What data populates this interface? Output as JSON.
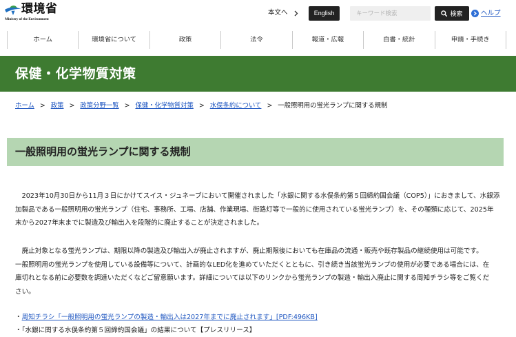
{
  "header": {
    "logo": {
      "title": "環境省",
      "subtitle": "Ministry of the Environment",
      "icon": "ministry-logo-icon"
    },
    "skip_link": {
      "label": "本文へ",
      "icon": "chevron-right-icon"
    },
    "english_button": {
      "label": "English"
    },
    "search": {
      "placeholder": "キーワード検索",
      "value": "",
      "button_label": "検索",
      "button_icon": "search-icon"
    },
    "help_link": {
      "label": "ヘルプ",
      "icon": "chevron-circle-right-icon"
    }
  },
  "nav": {
    "items": [
      "ホーム",
      "環境省について",
      "政策",
      "法令",
      "報道・広報",
      "白書・統計",
      "申請・手続き"
    ]
  },
  "section_banner": {
    "title": "保健・化学物質対策"
  },
  "breadcrumb": {
    "separator": ">",
    "links": [
      "ホーム",
      "政策",
      "政策分野一覧",
      "保健・化学物質対策",
      "水俣条約について"
    ],
    "current": "一般照明用の蛍光ランプに関する規制"
  },
  "main": {
    "heading": "一般照明用の蛍光ランプに関する規制",
    "paragraphs": [
      {
        "lines": [
          "2023年10月30日から11月３日にかけてスイス・ジュネーブにおいて開催されました「水銀に関する水俣条約第５回締約国会議（COP5）」におきまして、水銀添",
          "加製品である一般照明用の蛍光ランプ（住宅、事務所、工場、店舗、作業現場、街路灯等で一般的に使用されている蛍光ランプ）を、その種類に応じて、2025年",
          "末から2027年末までに製造及び輸出入を段階的に廃止することが決定されました。"
        ]
      },
      {
        "lines": [
          "廃止対象となる蛍光ランプは、期限以降の製造及び輸出入が廃止されますが、廃止期限後においても在庫品の流通・販売や既存製品の継続使用は可能です。",
          "一般照明用の蛍光ランプを使用している設備等について、計画的なLED化を進めていただくとともに、引き続き当該蛍光ランプの使用が必要である場合には、在",
          "庫切れとなる前に必要数を調達いただくなどご留意願います。詳細については以下のリンクから蛍光ランプの製造・輸出入廃止に関する周知チラシ等をご覧くだ",
          "さい。"
        ]
      }
    ],
    "links": [
      {
        "bullet": "・",
        "label": "周知チラシ「一般照明用の蛍光ランプの製造・輸出入は2027年までに廃止されます」[PDF:496KB]"
      },
      {
        "bullet": "・",
        "label": "「水銀に関する水俣条約第５回締約国会議」の結果について【プレスリリース】"
      }
    ]
  },
  "colors": {
    "banner_green": "#3e7b31",
    "heading_bg": "#b5d6b2",
    "link_blue": "#1d55c0",
    "button_dark": "#222222",
    "help_blue": "#2f6fd6",
    "text_dark": "#222222",
    "divider_gray": "#c9c9c9"
  }
}
